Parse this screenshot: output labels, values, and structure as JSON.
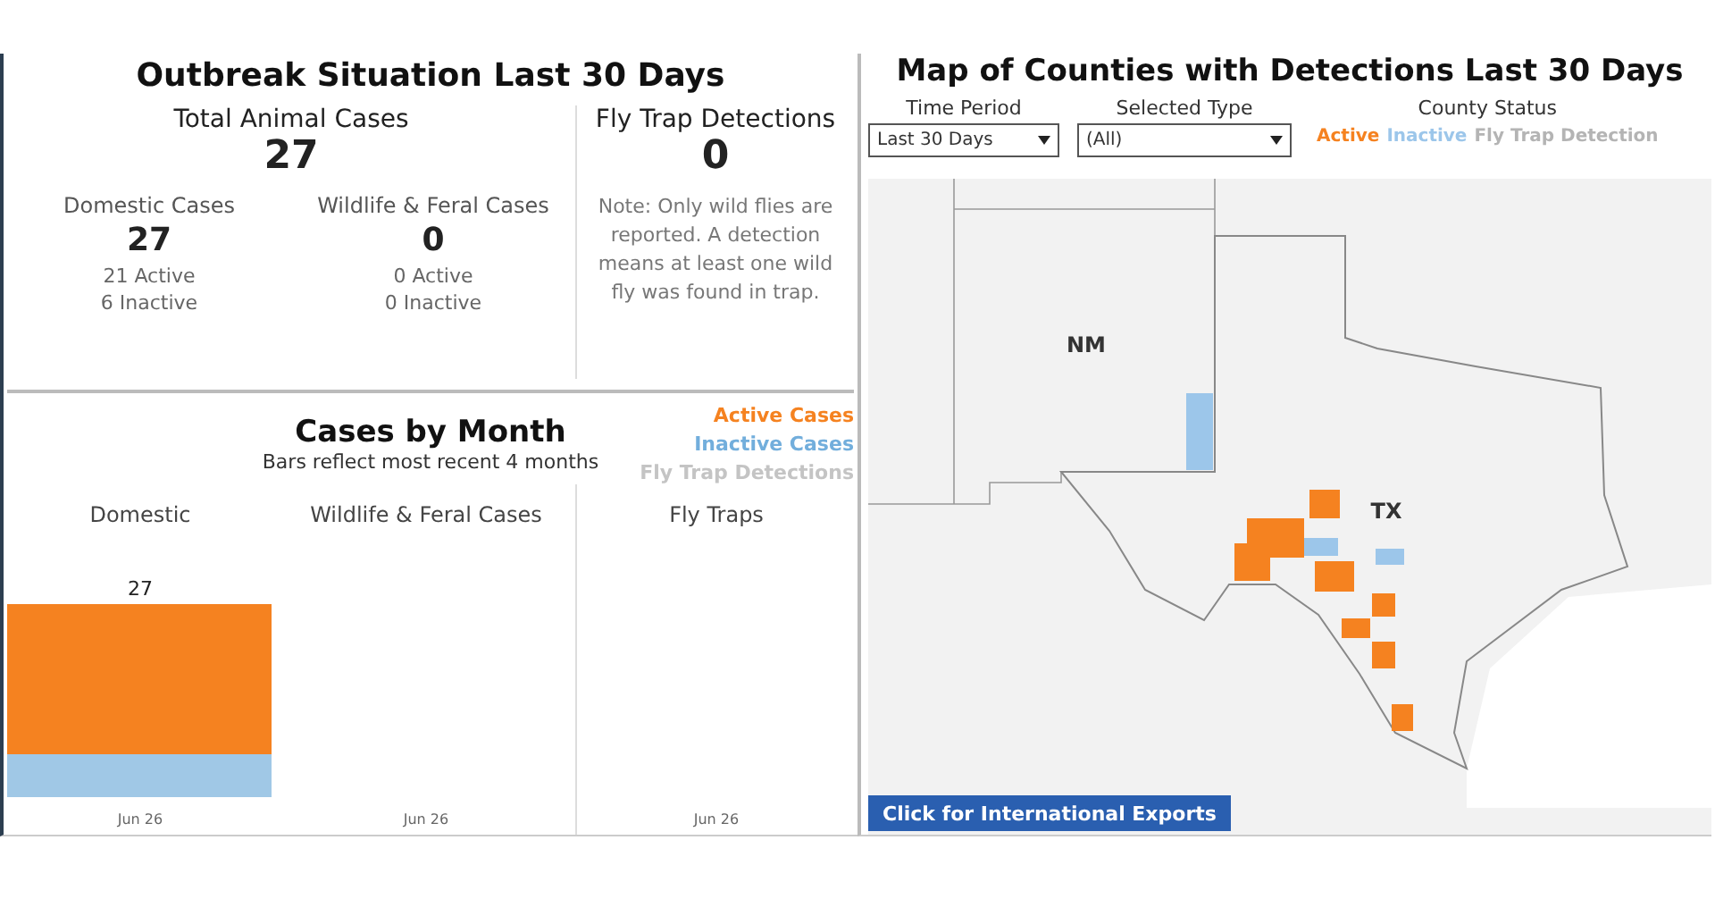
{
  "summary": {
    "title": "Outbreak Situation Last 30 Days",
    "total": {
      "label": "Total Animal Cases",
      "value": "27"
    },
    "groups": [
      {
        "label": "Domestic Cases",
        "value": "27",
        "lines": [
          "21 Active",
          "6 Inactive"
        ]
      },
      {
        "label": "Wildlife & Feral Cases",
        "value": "0",
        "lines": [
          "0 Active",
          "0 Inactive"
        ]
      }
    ],
    "traps": {
      "label": "Fly Trap Detections",
      "value": "0",
      "note": "Note: Only wild flies are reported. A detection means at least one wild fly was found in trap."
    }
  },
  "monthly": {
    "title": "Cases by Month",
    "subtitle": "Bars reflect most recent 4 months",
    "legend": [
      {
        "label": "Active Cases",
        "color": "#f58220"
      },
      {
        "label": "Inactive Cases",
        "color": "#72aedc"
      },
      {
        "label": "Fly Trap Detections",
        "color": "#c4c4c4"
      }
    ],
    "panels": [
      {
        "title": "Domestic",
        "kind": "bar",
        "total_label": "27",
        "axis_label": "Jun 26"
      },
      {
        "title": "Wildlife & Feral Cases",
        "axis_label": "Jun 26"
      },
      {
        "title": "Fly Traps",
        "axis_label": "Jun 26"
      }
    ]
  },
  "map": {
    "title": "Map of Counties with Detections Last 30 Days",
    "filters": [
      {
        "label": "Time Period",
        "value": "Last 30 Days"
      },
      {
        "label": "Selected Type",
        "value": "(All)"
      }
    ],
    "status_legend": {
      "label": "County Status",
      "items": [
        {
          "label": "Active",
          "color": "#f58220"
        },
        {
          "label": "Inactive",
          "color": "#9cc6ea"
        },
        {
          "label": "Fly Trap Detection",
          "color": "#b4b4b4"
        }
      ]
    },
    "state_labels": [
      "NM",
      "TX"
    ],
    "button": "Click for International Exports"
  }
}
